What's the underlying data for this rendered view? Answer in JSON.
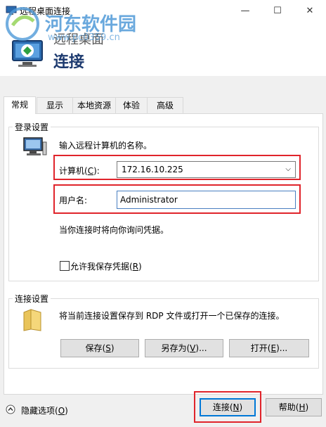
{
  "window": {
    "title": "远程桌面连接",
    "minimize_glyph": "—",
    "maximize_glyph": "☐",
    "close_glyph": "✕"
  },
  "header": {
    "subtitle": "远程桌面",
    "title": "连接"
  },
  "watermark": {
    "site_name": "河东软件园",
    "url": "www.pc0359.cn"
  },
  "tabs": [
    {
      "label": "常规",
      "active": true
    },
    {
      "label": "显示",
      "active": false
    },
    {
      "label": "本地资源",
      "active": false
    },
    {
      "label": "体验",
      "active": false
    },
    {
      "label": "高级",
      "active": false
    }
  ],
  "login": {
    "group_title": "登录设置",
    "instruction": "输入远程计算机的名称。",
    "computer_label_prefix": "计算机(",
    "computer_label_key": "C",
    "computer_label_suffix": "):",
    "computer_value": "172.16.10.225",
    "username_label": "用户名:",
    "username_value": "Administrator",
    "credentials_note": "当你连接时将向你询问凭据。",
    "save_cred_prefix": "允许我保存凭据(",
    "save_cred_key": "R",
    "save_cred_suffix": ")",
    "save_cred_checked": false
  },
  "connection": {
    "group_title": "连接设置",
    "description": "将当前连接设置保存到 RDP 文件或打开一个已保存的连接。",
    "save_prefix": "保存(",
    "save_key": "S",
    "save_suffix": ")",
    "saveas_prefix": "另存为(",
    "saveas_key": "V",
    "saveas_suffix": ")...",
    "open_prefix": "打开(",
    "open_key": "E",
    "open_suffix": ")..."
  },
  "footer": {
    "hide_options_prefix": "隐藏选项(",
    "hide_options_key": "O",
    "hide_options_suffix": ")",
    "connect_prefix": "连接(",
    "connect_key": "N",
    "connect_suffix": ")",
    "help_prefix": "帮助(",
    "help_key": "H",
    "help_suffix": ")"
  },
  "colors": {
    "highlight": "#e0242b",
    "accent": "#0078d7",
    "header_title": "#1d3a6f"
  }
}
